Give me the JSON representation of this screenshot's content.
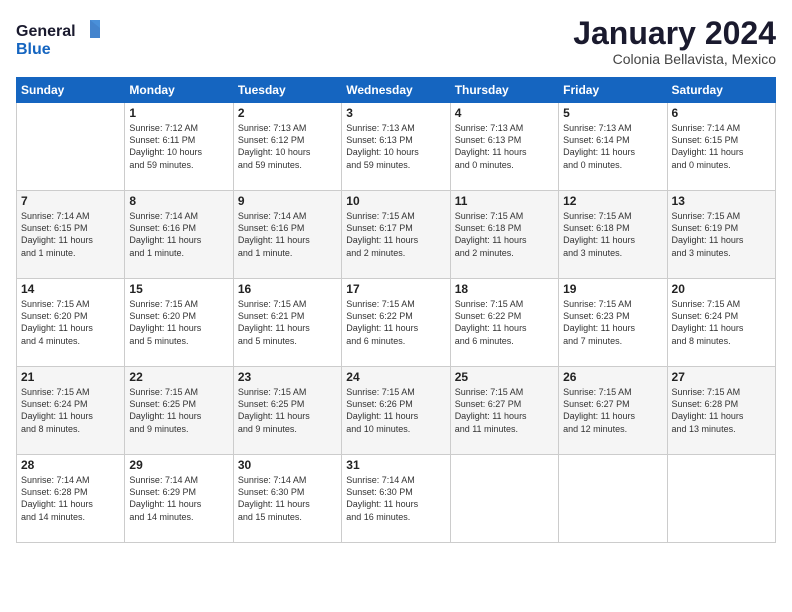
{
  "header": {
    "logo_line1": "General",
    "logo_line2": "Blue",
    "month_title": "January 2024",
    "location": "Colonia Bellavista, Mexico"
  },
  "days_of_week": [
    "Sunday",
    "Monday",
    "Tuesday",
    "Wednesday",
    "Thursday",
    "Friday",
    "Saturday"
  ],
  "weeks": [
    [
      {
        "num": "",
        "info": ""
      },
      {
        "num": "1",
        "info": "Sunrise: 7:12 AM\nSunset: 6:11 PM\nDaylight: 10 hours\nand 59 minutes."
      },
      {
        "num": "2",
        "info": "Sunrise: 7:13 AM\nSunset: 6:12 PM\nDaylight: 10 hours\nand 59 minutes."
      },
      {
        "num": "3",
        "info": "Sunrise: 7:13 AM\nSunset: 6:13 PM\nDaylight: 10 hours\nand 59 minutes."
      },
      {
        "num": "4",
        "info": "Sunrise: 7:13 AM\nSunset: 6:13 PM\nDaylight: 11 hours\nand 0 minutes."
      },
      {
        "num": "5",
        "info": "Sunrise: 7:13 AM\nSunset: 6:14 PM\nDaylight: 11 hours\nand 0 minutes."
      },
      {
        "num": "6",
        "info": "Sunrise: 7:14 AM\nSunset: 6:15 PM\nDaylight: 11 hours\nand 0 minutes."
      }
    ],
    [
      {
        "num": "7",
        "info": "Sunrise: 7:14 AM\nSunset: 6:15 PM\nDaylight: 11 hours\nand 1 minute."
      },
      {
        "num": "8",
        "info": "Sunrise: 7:14 AM\nSunset: 6:16 PM\nDaylight: 11 hours\nand 1 minute."
      },
      {
        "num": "9",
        "info": "Sunrise: 7:14 AM\nSunset: 6:16 PM\nDaylight: 11 hours\nand 1 minute."
      },
      {
        "num": "10",
        "info": "Sunrise: 7:15 AM\nSunset: 6:17 PM\nDaylight: 11 hours\nand 2 minutes."
      },
      {
        "num": "11",
        "info": "Sunrise: 7:15 AM\nSunset: 6:18 PM\nDaylight: 11 hours\nand 2 minutes."
      },
      {
        "num": "12",
        "info": "Sunrise: 7:15 AM\nSunset: 6:18 PM\nDaylight: 11 hours\nand 3 minutes."
      },
      {
        "num": "13",
        "info": "Sunrise: 7:15 AM\nSunset: 6:19 PM\nDaylight: 11 hours\nand 3 minutes."
      }
    ],
    [
      {
        "num": "14",
        "info": "Sunrise: 7:15 AM\nSunset: 6:20 PM\nDaylight: 11 hours\nand 4 minutes."
      },
      {
        "num": "15",
        "info": "Sunrise: 7:15 AM\nSunset: 6:20 PM\nDaylight: 11 hours\nand 5 minutes."
      },
      {
        "num": "16",
        "info": "Sunrise: 7:15 AM\nSunset: 6:21 PM\nDaylight: 11 hours\nand 5 minutes."
      },
      {
        "num": "17",
        "info": "Sunrise: 7:15 AM\nSunset: 6:22 PM\nDaylight: 11 hours\nand 6 minutes."
      },
      {
        "num": "18",
        "info": "Sunrise: 7:15 AM\nSunset: 6:22 PM\nDaylight: 11 hours\nand 6 minutes."
      },
      {
        "num": "19",
        "info": "Sunrise: 7:15 AM\nSunset: 6:23 PM\nDaylight: 11 hours\nand 7 minutes."
      },
      {
        "num": "20",
        "info": "Sunrise: 7:15 AM\nSunset: 6:24 PM\nDaylight: 11 hours\nand 8 minutes."
      }
    ],
    [
      {
        "num": "21",
        "info": "Sunrise: 7:15 AM\nSunset: 6:24 PM\nDaylight: 11 hours\nand 8 minutes."
      },
      {
        "num": "22",
        "info": "Sunrise: 7:15 AM\nSunset: 6:25 PM\nDaylight: 11 hours\nand 9 minutes."
      },
      {
        "num": "23",
        "info": "Sunrise: 7:15 AM\nSunset: 6:25 PM\nDaylight: 11 hours\nand 9 minutes."
      },
      {
        "num": "24",
        "info": "Sunrise: 7:15 AM\nSunset: 6:26 PM\nDaylight: 11 hours\nand 10 minutes."
      },
      {
        "num": "25",
        "info": "Sunrise: 7:15 AM\nSunset: 6:27 PM\nDaylight: 11 hours\nand 11 minutes."
      },
      {
        "num": "26",
        "info": "Sunrise: 7:15 AM\nSunset: 6:27 PM\nDaylight: 11 hours\nand 12 minutes."
      },
      {
        "num": "27",
        "info": "Sunrise: 7:15 AM\nSunset: 6:28 PM\nDaylight: 11 hours\nand 13 minutes."
      }
    ],
    [
      {
        "num": "28",
        "info": "Sunrise: 7:14 AM\nSunset: 6:28 PM\nDaylight: 11 hours\nand 14 minutes."
      },
      {
        "num": "29",
        "info": "Sunrise: 7:14 AM\nSunset: 6:29 PM\nDaylight: 11 hours\nand 14 minutes."
      },
      {
        "num": "30",
        "info": "Sunrise: 7:14 AM\nSunset: 6:30 PM\nDaylight: 11 hours\nand 15 minutes."
      },
      {
        "num": "31",
        "info": "Sunrise: 7:14 AM\nSunset: 6:30 PM\nDaylight: 11 hours\nand 16 minutes."
      },
      {
        "num": "",
        "info": ""
      },
      {
        "num": "",
        "info": ""
      },
      {
        "num": "",
        "info": ""
      }
    ]
  ]
}
